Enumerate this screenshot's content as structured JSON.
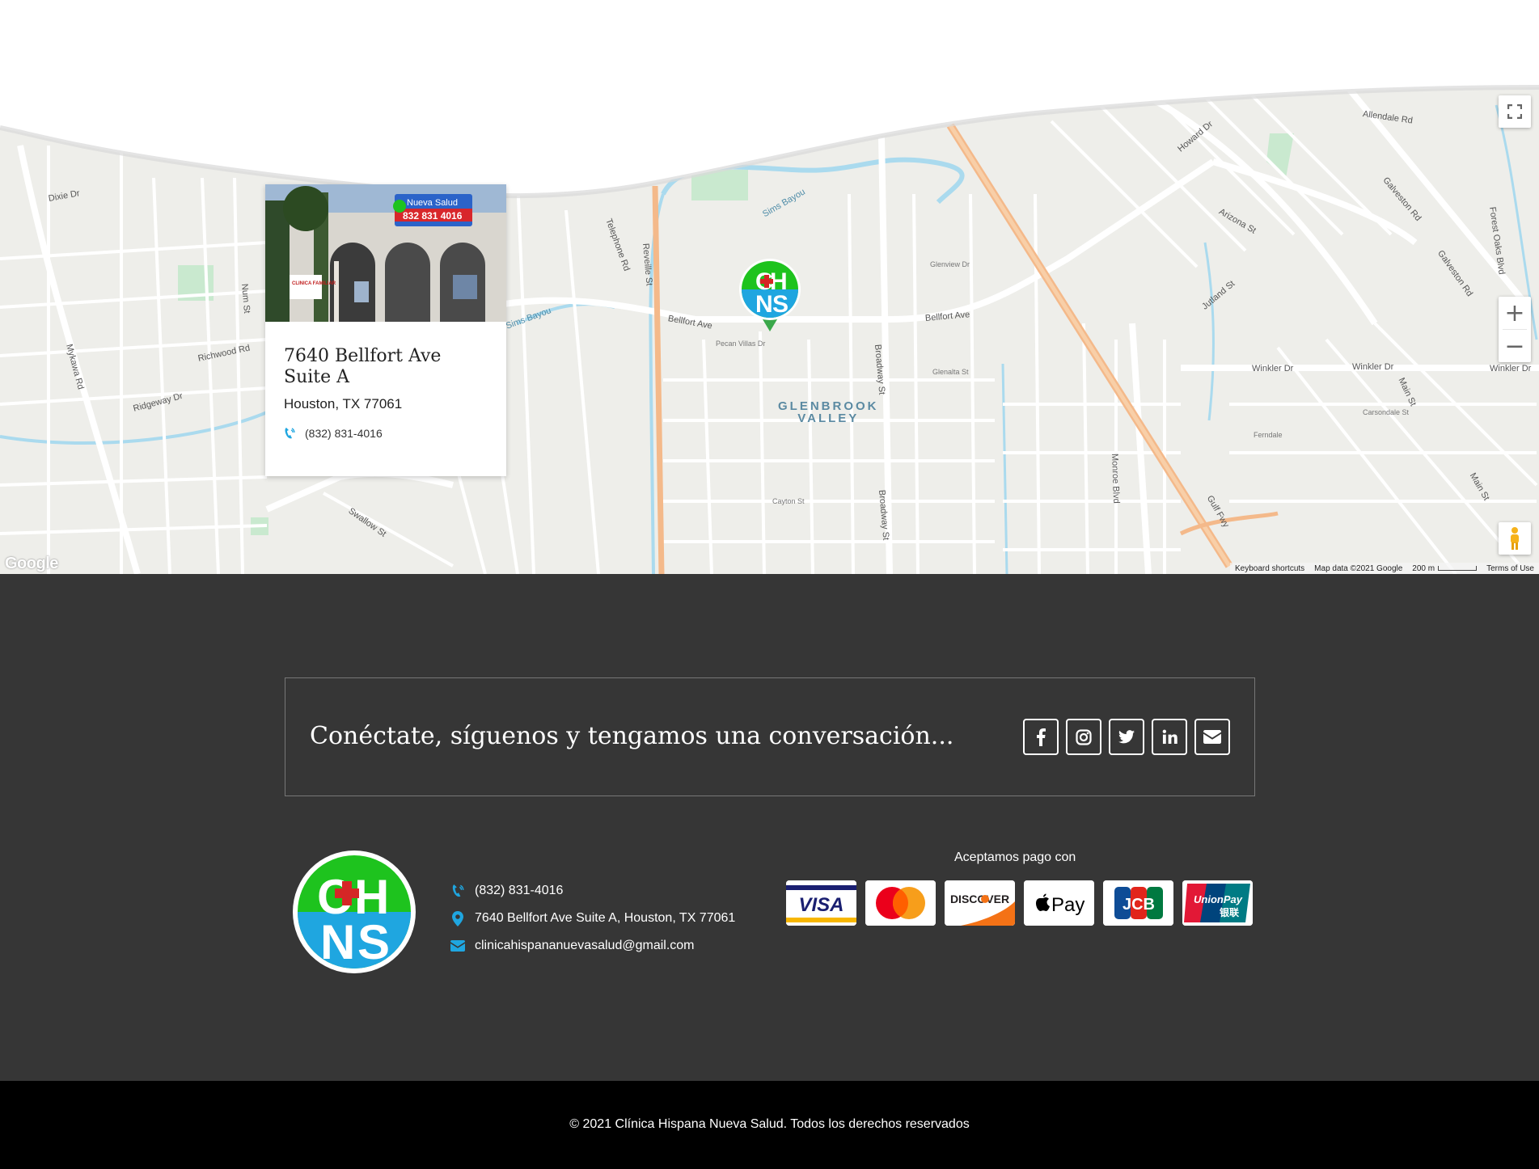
{
  "map": {
    "info_card": {
      "address_line1": "7640 Bellfort Ave",
      "address_line2": "Suite A",
      "city": "Houston, TX 77061",
      "phone": "(832) 831-4016",
      "photo_sign_name": "Nueva Salud",
      "photo_sign_phone": "832 831 4016",
      "photo_banner": "CLINICA FAMILIAR"
    },
    "neighborhood": [
      "GLENBROOK",
      "VALLEY"
    ],
    "streets": [
      "Dixie Dr",
      "Mykawa Rd",
      "Telephone Rd",
      "Reveille St",
      "Bellfort Ave",
      "Bellfort Ave",
      "Sims Bayou",
      "Broadway St",
      "Broadway St",
      "Howard Dr",
      "Arizona St",
      "Jutland St",
      "Galveston Rd",
      "Galveston Rd",
      "Allendale Rd",
      "Winkler Dr",
      "Winkler Dr",
      "Winkler Dr",
      "Main St",
      "Main St",
      "Monroe Blvd",
      "Gulf Fwy",
      "Swallow St",
      "Ridgeway Dr",
      "Richwood Rd",
      "Forest Oaks Blvd",
      "Sims Bayou",
      "Num St",
      "Pecan Villas Dr",
      "Glenalta St",
      "Ferndale",
      "Carsondale St",
      "Glenview Dr",
      "Cayton St"
    ],
    "controls": {
      "zoom_in": "+",
      "zoom_out": "−"
    },
    "attribution": {
      "google": "Google",
      "shortcuts": "Keyboard shortcuts",
      "map_data": "Map data ©2021 Google",
      "scale": "200 m",
      "terms": "Terms of Use"
    },
    "marker_icon": "clinic-logo-marker"
  },
  "footer": {
    "connect_text": "Conéctate, síguenos y tengamos una conversación...",
    "social": [
      "facebook-icon",
      "instagram-icon",
      "twitter-icon",
      "linkedin-icon",
      "email-icon"
    ],
    "contact": {
      "phone": "(832) 831-4016",
      "address": "7640 Bellfort Ave Suite A, Houston, TX 77061",
      "email": "clinicahispananuevasalud@gmail.com"
    },
    "payment_label": "Aceptamos pago con",
    "payment_cards": {
      "visa": "VISA",
      "discover": "DISCOVER",
      "applepay": "Pay",
      "jcb": "JCB",
      "unionpay": "UnionPay",
      "unionpay_cn": "银联"
    },
    "copyright": "© 2021 Clínica Hispana Nueva Salud. Todos los derechos reservados"
  },
  "colors": {
    "footer_bg": "#363636",
    "copyright_bg": "#000000",
    "accent_blue": "#1fa6e0",
    "logo_green": "#1ec31e",
    "logo_blue": "#1fa6e0",
    "highway": "#f4b98a",
    "water": "#aadaee"
  }
}
